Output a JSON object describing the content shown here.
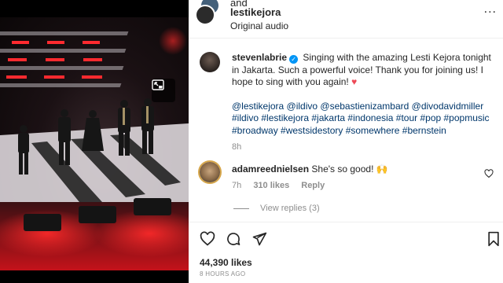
{
  "header": {
    "and_text": "and",
    "username": "lestikejora",
    "audio": "Original audio",
    "more": "..."
  },
  "caption": {
    "username": "stevenlabrie",
    "text": "Singing with the amazing Lesti Kejora tonight in Jakarta. Such a powerful voice! Thank you for joining us! I hope to sing with you again!",
    "heart": "♥",
    "hashtags": "@lestikejora @ildivo @sebastienizambard @divodavidmiller #ildivo #lestikejora #jakarta #indonesia #tour #pop #popmusic #broadway #westsidestory #somewhere #bernstein",
    "time": "8h"
  },
  "comment": {
    "username": "adamreednielsen",
    "text": "She's so good!",
    "emoji": "🙌",
    "time": "7h",
    "likes": "310 likes",
    "reply": "Reply",
    "view_replies": "View replies (3)"
  },
  "post": {
    "likes": "44,390 likes",
    "ago": "8 HOURS AGO"
  },
  "colors": {
    "link": "#00376b",
    "verified": "#0095f6",
    "muted": "#8e8e8e",
    "text": "#262626"
  },
  "icons": [
    "picture-in-picture-icon",
    "heart-icon",
    "comment-icon",
    "share-icon",
    "bookmark-icon",
    "verified-icon",
    "more-icon"
  ]
}
